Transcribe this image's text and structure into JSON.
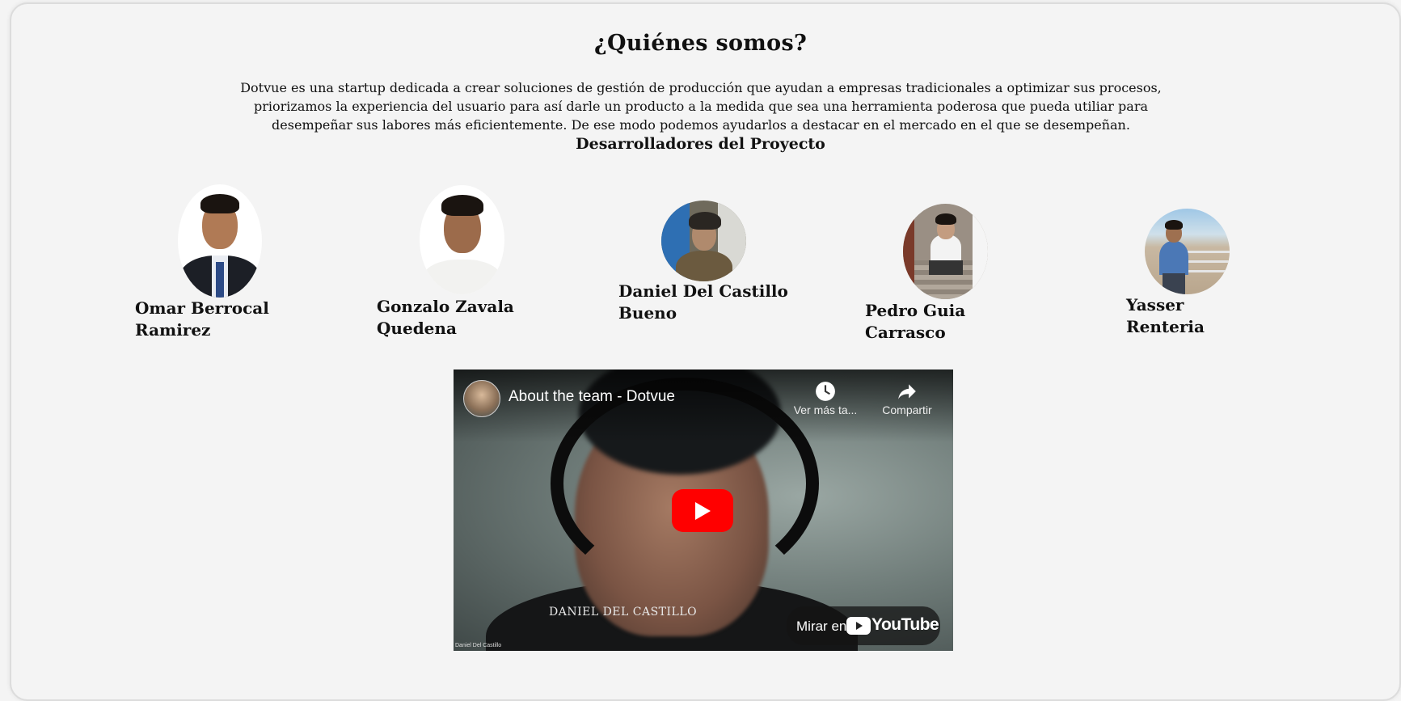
{
  "about": {
    "title": "¿Quiénes somos?",
    "description": "Dotvue es una startup dedicada a crear soluciones de gestión de producción que ayudan a empresas tradicionales a optimizar sus procesos, priorizamos la experiencia del usuario para así darle un producto a la medida que sea una herramienta poderosa que pueda utiliar para desempeñar sus labores más eficientemente. De ese modo podemos ayudarlos a destacar en el mercado en el que se desempeñan.",
    "developers_heading": "Desarrolladores del Proyecto"
  },
  "members": [
    {
      "name": "Omar Berrocal Ramirez"
    },
    {
      "name": "Gonzalo Zavala Quedena"
    },
    {
      "name": "Daniel Del Castillo Bueno"
    },
    {
      "name": "Pedro Guia Carrasco"
    },
    {
      "name": "Yasser Renteria"
    }
  ],
  "video": {
    "title": "About the team - Dotvue",
    "watch_later": "Ver más ta...",
    "share": "Compartir",
    "overlay_text": "DANIEL DEL CASTILLO",
    "corner_text": "Daniel Del Castillo",
    "watch_on": "Mirar en",
    "platform": "YouTube",
    "play_color": "#ff0000"
  }
}
